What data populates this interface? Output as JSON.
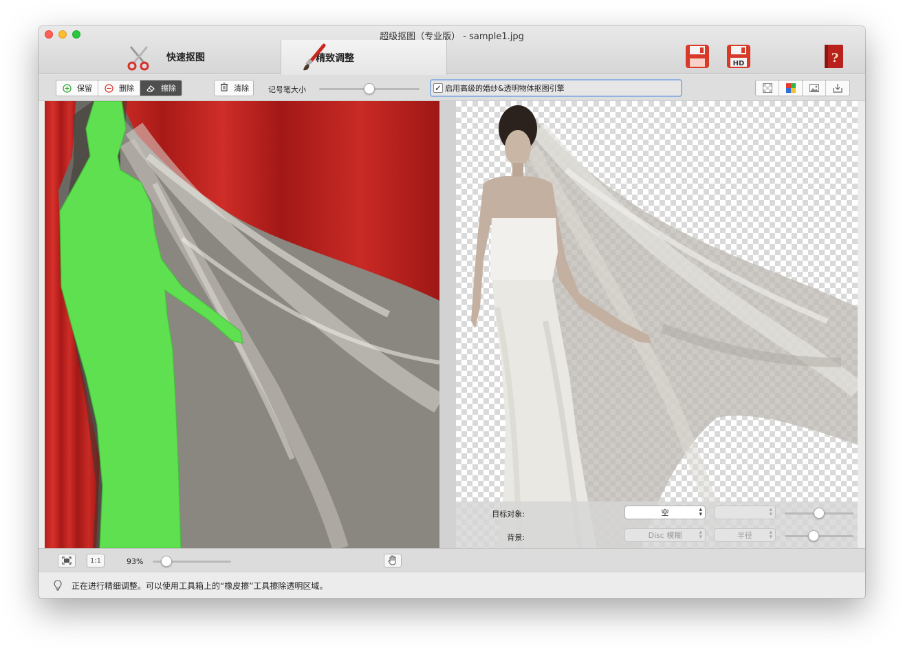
{
  "window": {
    "title": "超级抠图（专业版） - sample1.jpg"
  },
  "tabs": [
    {
      "label": "快速抠图",
      "icon": "scissors-icon"
    },
    {
      "label": "精致调整",
      "icon": "brush-icon"
    }
  ],
  "header_buttons": [
    "save-icon",
    "save-hd-icon",
    "help-book-icon"
  ],
  "header_text": {
    "hd": "HD",
    "help": "?"
  },
  "toolbar": {
    "keep_label": "保留",
    "delete_label": "删除",
    "erase_label": "擦除",
    "clear_label": "清除",
    "brush_size_label": "记号笔大小",
    "brush_size_level": 0.5,
    "engine_label": "启用高级的婚纱&透明物体抠图引擎",
    "engine_checked": true,
    "view_buttons": [
      "transparent-bg-icon",
      "color-bg-icon",
      "image-bg-icon",
      "export-icon"
    ]
  },
  "properties": {
    "target_label": "目标对象:",
    "target_value": "空",
    "target_secondary_value": "",
    "target_slider_level": 0.5,
    "background_label": "背景:",
    "background_blur_value": "Disc 模糊",
    "background_radius_value": "半径",
    "background_slider_level": 0.4
  },
  "bottombar": {
    "fit_icon": "fit-screen-icon",
    "actual_size_label": "1:1",
    "zoom_label": "93%",
    "zoom_level": 0.12,
    "hand_icon": "hand-icon"
  },
  "status": {
    "icon": "lightbulb-icon",
    "text": "正在进行精细调整。可以使用工具箱上的“橡皮擦”工具擦除透明区域。"
  },
  "colors": {
    "keep_green": "#5fe050",
    "delete_red": "#c0201e",
    "engine_focus": "#8fb2e0",
    "save_red": "#d83a2a"
  }
}
